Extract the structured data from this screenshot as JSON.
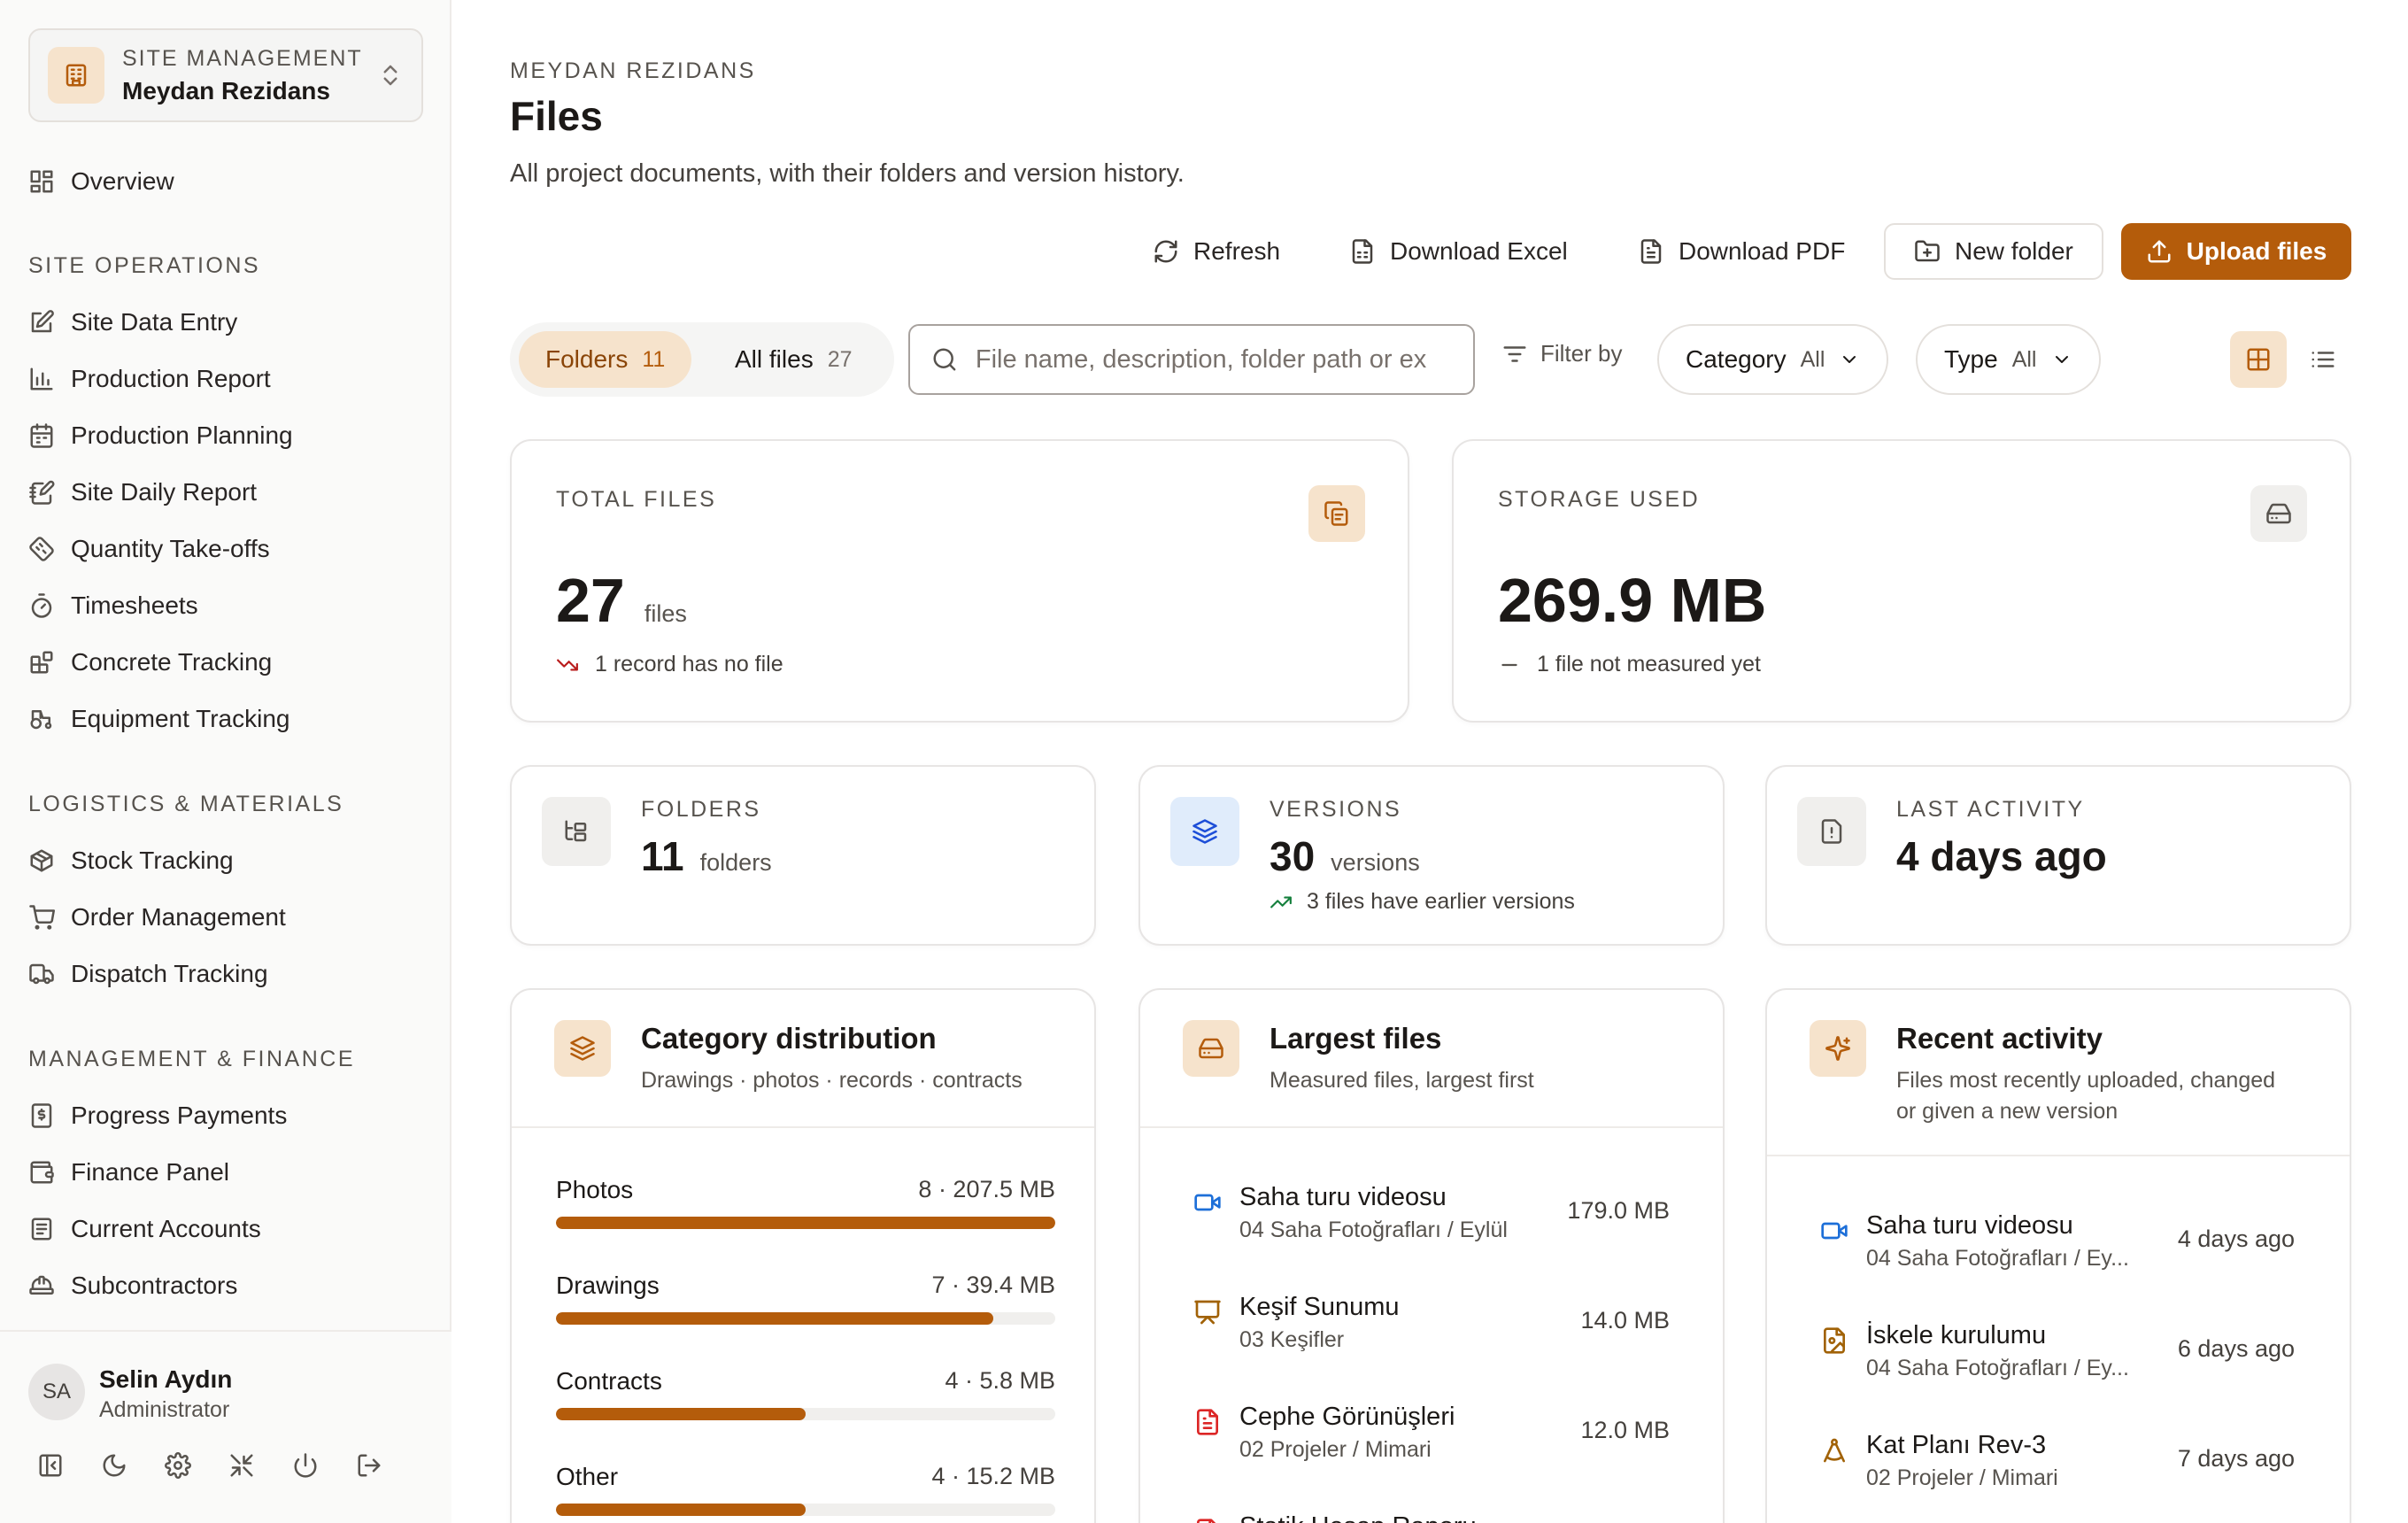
{
  "sidebar": {
    "site_kicker": "SITE MANAGEMENT",
    "site_name": "Meydan Rezidans",
    "overview": "Overview",
    "sections": {
      "site_operations": "SITE OPERATIONS",
      "logistics": "LOGISTICS & MATERIALS",
      "management": "MANAGEMENT & FINANCE"
    },
    "site_operations_items": [
      "Site Data Entry",
      "Production Report",
      "Production Planning",
      "Site Daily Report",
      "Quantity Take-offs",
      "Timesheets",
      "Concrete Tracking",
      "Equipment Tracking"
    ],
    "logistics_items": [
      "Stock Tracking",
      "Order Management",
      "Dispatch Tracking"
    ],
    "management_items": [
      "Progress Payments",
      "Finance Panel",
      "Current Accounts",
      "Subcontractors"
    ],
    "user": {
      "initials": "SA",
      "name": "Selin Aydın",
      "role": "Administrator"
    }
  },
  "header": {
    "kicker": "MEYDAN REZIDANS",
    "title": "Files",
    "description": "All project documents, with their folders and version history."
  },
  "toolbar": {
    "refresh": "Refresh",
    "download_excel": "Download Excel",
    "download_pdf": "Download PDF",
    "new_folder": "New folder",
    "upload": "Upload files"
  },
  "filters": {
    "folders_label": "Folders",
    "folders_count": "11",
    "all_files_label": "All files",
    "all_files_count": "27",
    "search_placeholder": "File name, description, folder path or ex",
    "filter_by": "Filter by",
    "category_label": "Category",
    "category_value": "All",
    "type_label": "Type",
    "type_value": "All"
  },
  "stats": {
    "total_files": {
      "label": "TOTAL FILES",
      "value": "27",
      "unit": "files",
      "note": "1 record has no file"
    },
    "storage": {
      "label": "STORAGE USED",
      "value": "269.9 MB",
      "note": "1 file not measured yet"
    },
    "folders": {
      "label": "FOLDERS",
      "value": "11",
      "unit": "folders"
    },
    "versions": {
      "label": "VERSIONS",
      "value": "30",
      "unit": "versions",
      "note": "3 files have earlier versions"
    },
    "last_activity": {
      "label": "LAST ACTIVITY",
      "value": "4 days ago"
    }
  },
  "category_panel": {
    "title": "Category distribution",
    "subtitle": "Drawings · photos · records · contracts",
    "rows": [
      {
        "label": "Photos",
        "meta": "8 · 207.5 MB",
        "fraction": 1.0
      },
      {
        "label": "Drawings",
        "meta": "7 · 39.4 MB",
        "fraction": 0.875
      },
      {
        "label": "Contracts",
        "meta": "4 · 5.8 MB",
        "fraction": 0.5
      },
      {
        "label": "Other",
        "meta": "4 · 15.2 MB",
        "fraction": 0.5
      }
    ]
  },
  "largest_panel": {
    "title": "Largest files",
    "subtitle": "Measured files, largest first",
    "files": [
      {
        "name": "Saha turu videosu",
        "path": "04 Saha Fotoğrafları / Eylül",
        "size": "179.0 MB",
        "icon": "video-icon",
        "color": "#1d6fd8"
      },
      {
        "name": "Keşif Sunumu",
        "path": "03 Keşifler",
        "size": "14.0 MB",
        "icon": "presentation-icon",
        "color": "#a16207"
      },
      {
        "name": "Cephe Görünüşleri",
        "path": "02 Projeler / Mimari",
        "size": "12.0 MB",
        "icon": "pdf-file-icon",
        "color": "#dc2626"
      },
      {
        "name": "Statik Hesap Raporu",
        "path": "",
        "size": "",
        "icon": "file-icon",
        "color": "#dc2626"
      }
    ]
  },
  "activity_panel": {
    "title": "Recent activity",
    "subtitle_line1": "Files most recently uploaded, changed",
    "subtitle_line2": "or given a new version",
    "items": [
      {
        "name": "Saha turu videosu",
        "path": "04 Saha Fotoğrafları / Ey...",
        "when": "4 days ago",
        "icon": "video-icon",
        "color": "#1d6fd8"
      },
      {
        "name": "İskele kurulumu",
        "path": "04 Saha Fotoğrafları / Ey...",
        "when": "6 days ago",
        "icon": "image-file-icon",
        "color": "#a16207"
      },
      {
        "name": "Kat Planı Rev-3",
        "path": "02 Projeler / Mimari",
        "when": "7 days ago",
        "icon": "drafting-compass-icon",
        "color": "#a16207"
      }
    ]
  },
  "colors": {
    "accent": "#b45c0b",
    "accent_soft": "#f6e3cc",
    "trend_down": "#b91c1c",
    "trend_up": "#15803d"
  }
}
